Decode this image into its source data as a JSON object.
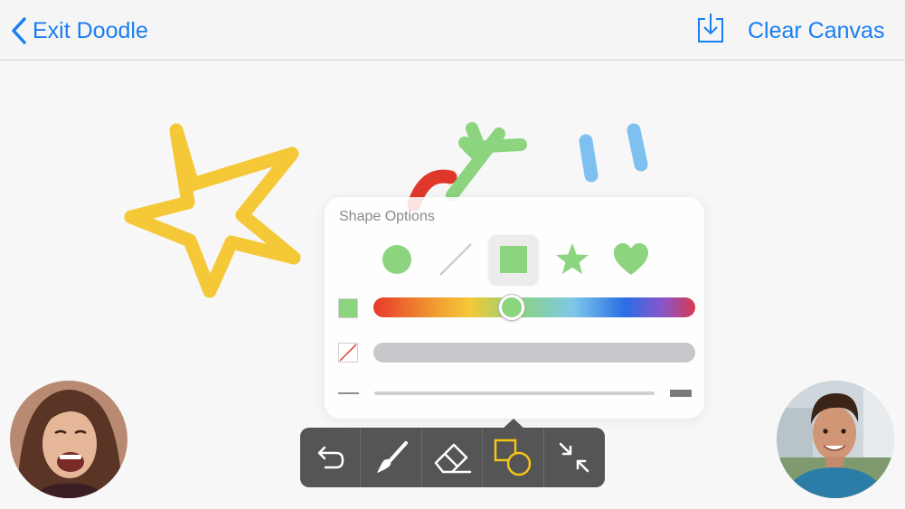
{
  "header": {
    "exit_label": "Exit Doodle",
    "clear_label": "Clear Canvas"
  },
  "shape_options": {
    "title": "Shape Options",
    "shapes": [
      "circle",
      "line",
      "square",
      "star",
      "heart"
    ],
    "selected_shape": "square",
    "fill_color": "#8cd47e",
    "fill_hue_fraction": 0.43,
    "stroke_color": "none"
  },
  "toolbar": {
    "tools": [
      "undo-icon",
      "brush-icon",
      "eraser-icon",
      "shapes-icon",
      "collapse-icon"
    ],
    "active_tool": "shapes-icon"
  },
  "colors": {
    "accent": "#1a7ef2",
    "toolbar_bg": "#555555",
    "active_tool": "#f5c518",
    "doodle_yellow": "#f5c838",
    "doodle_red": "#e0372b",
    "doodle_green": "#8cd47e",
    "doodle_blue": "#7ec0f0"
  }
}
